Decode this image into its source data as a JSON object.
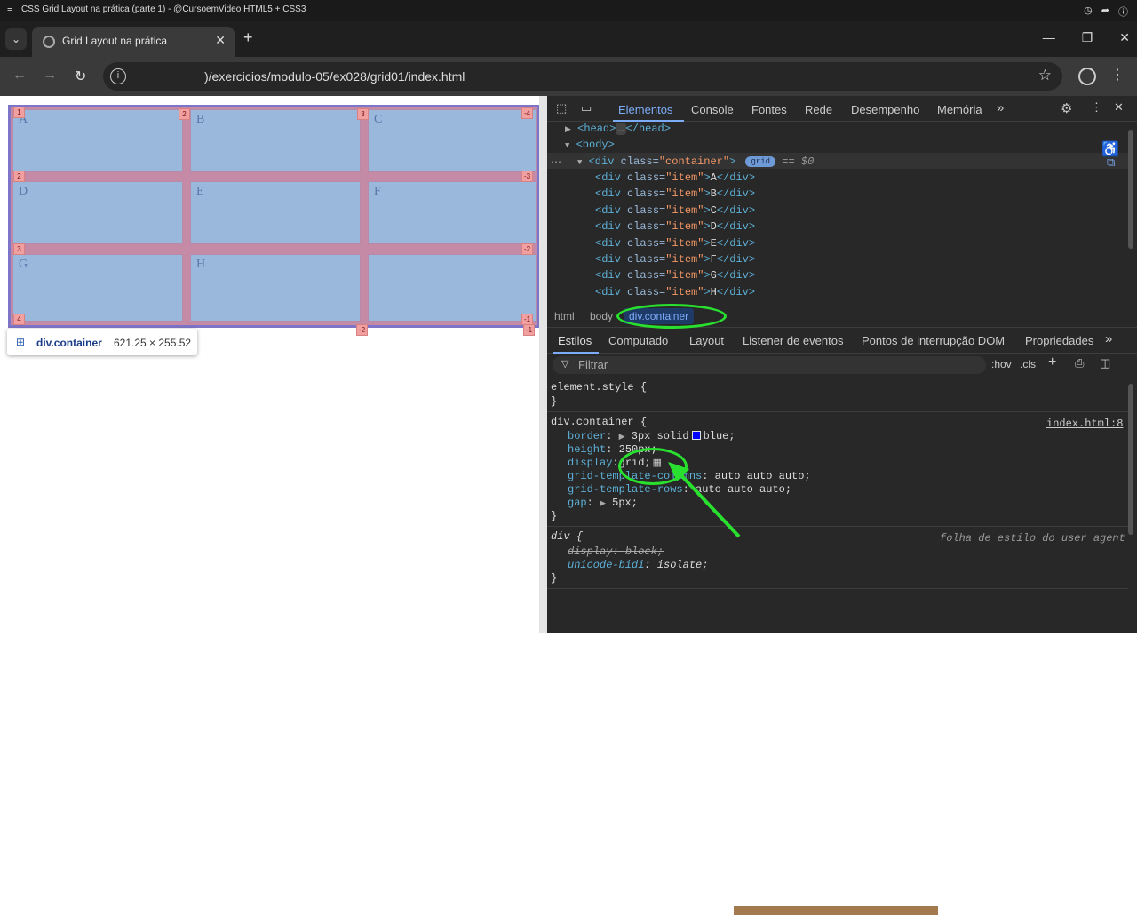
{
  "video_bar": {
    "title": "CSS Grid Layout na prática (parte 1) - @CursoemVideo HTML5 + CSS3"
  },
  "browser": {
    "tab_title": "Grid Layout na prática",
    "url": ")/exercicios/modulo-05/ex028/grid01/index.html"
  },
  "page": {
    "grid_items": [
      "A",
      "B",
      "C",
      "D",
      "E",
      "F",
      "G",
      "H",
      ""
    ],
    "line_numbers": {
      "top": [
        "1",
        "2",
        "3",
        "-4"
      ],
      "left": [
        "1",
        "2",
        "3",
        "4"
      ],
      "right": [
        "-3",
        "-2",
        "-1"
      ],
      "bottom": [
        "-2",
        "-1"
      ]
    },
    "tooltip": {
      "selector": "div.container",
      "dimensions": "621.25 × 255.52"
    }
  },
  "devtools": {
    "tabs": [
      "Elementos",
      "Console",
      "Fontes",
      "Rede",
      "Desempenho",
      "Memória"
    ],
    "more": "»",
    "dom": {
      "head": "<head>",
      "head_close": "</head>",
      "ellipsis": "…",
      "body": "<body>",
      "div_open": "<div ",
      "class_attr": "class=",
      "container_val": "\"container\"",
      "close_gt": ">",
      "grid_badge": "grid",
      "eq": "== $0",
      "items": [
        {
          "cls": "\"item\"",
          "text": "A"
        },
        {
          "cls": "\"item\"",
          "text": "B"
        },
        {
          "cls": "\"item\"",
          "text": "C"
        },
        {
          "cls": "\"item\"",
          "text": "D"
        },
        {
          "cls": "\"item\"",
          "text": "E"
        },
        {
          "cls": "\"item\"",
          "text": "F"
        },
        {
          "cls": "\"item\"",
          "text": "G"
        },
        {
          "cls": "\"item\"",
          "text": "H"
        }
      ],
      "div_close": "</div>"
    },
    "breadcrumbs": [
      "html",
      "body",
      "div.container"
    ],
    "subtabs": [
      "Estilos",
      "Computado",
      "Layout",
      "Listener de eventos",
      "Pontos de interrupção DOM",
      "Propriedades"
    ],
    "filter": {
      "placeholder": "Filtrar",
      "hov": ":hov",
      "cls": ".cls"
    },
    "styles": {
      "element_style": "element.style {",
      "close": "}",
      "container_selector": "div.container {",
      "source": "index.html:8",
      "props": [
        {
          "name": "border",
          "value": "3px solid",
          "color_name": "blue;",
          "color": "#0000ff"
        },
        {
          "name": "height",
          "value": "250px;"
        },
        {
          "name": "display",
          "value": "grid;"
        },
        {
          "name": "grid-template-columns",
          "value": "auto auto auto;"
        },
        {
          "name": "grid-template-rows",
          "value": "auto auto auto;"
        },
        {
          "name": "gap",
          "value": "5px;"
        }
      ],
      "ua_selector": "div {",
      "ua_source": "folha de estilo do user agent",
      "ua_props": [
        {
          "name": "display",
          "value": "block;"
        },
        {
          "name": "unicode-bidi",
          "value": "isolate;"
        }
      ]
    },
    "colors": {
      "accent": "#7cacf8",
      "highlight": "#29e02f"
    }
  }
}
